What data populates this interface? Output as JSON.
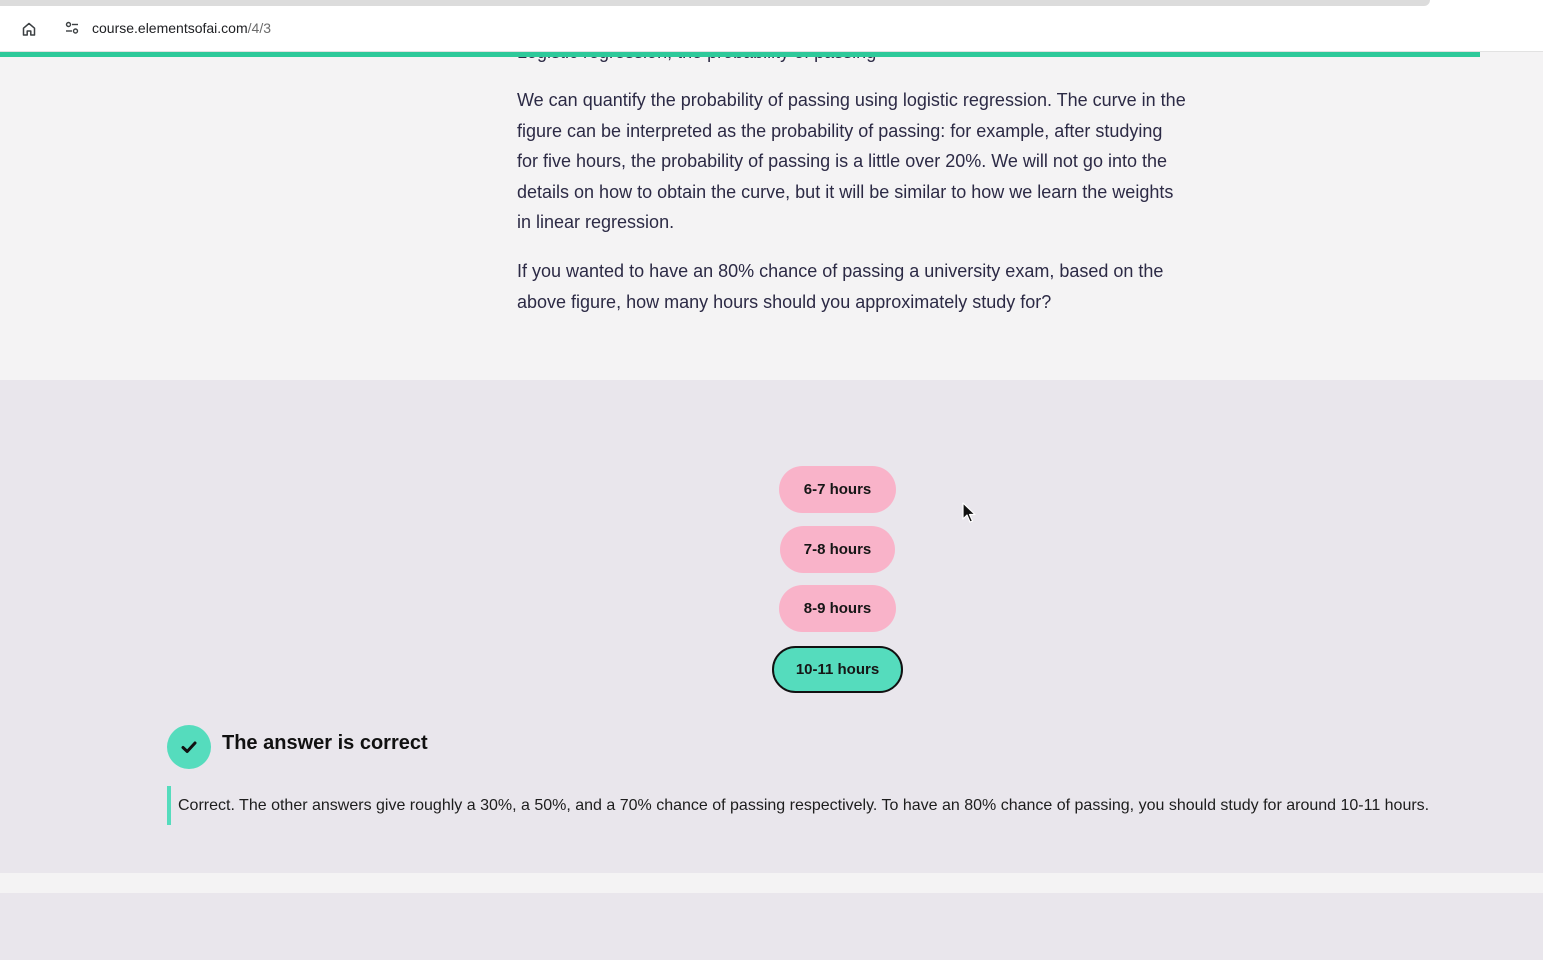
{
  "browser": {
    "url_domain": "course.elementsofai.com",
    "url_path": "/4/3",
    "icons": {
      "home": "home-icon",
      "site_info": "site-settings-icon"
    }
  },
  "reading_progress": {
    "fraction": 0.959,
    "color": "#2ec99a"
  },
  "article": {
    "cut_off_line": "Logistic regression, the probability of passing",
    "paragraphs": [
      "We can quantify the probability of passing using logistic regression. The curve in the figure can be interpreted as the probability of passing: for example, after studying for five hours, the probability of passing is a little over 20%. We will not go into the details on how to obtain the curve, but it will be similar to how we learn the weights in linear regression.",
      "If you wanted to have an 80% chance of passing a university exam, based on the above figure, how many hours should you approximately study for?"
    ]
  },
  "quiz": {
    "options": [
      {
        "label": "6-7 hours",
        "state": "incorrect"
      },
      {
        "label": "7-8 hours",
        "state": "incorrect"
      },
      {
        "label": "8-9 hours",
        "state": "incorrect"
      },
      {
        "label": "10-11 hours",
        "state": "selected-correct"
      }
    ],
    "result": {
      "icon": "checkmark-icon",
      "title": "The answer is correct",
      "feedback": "Correct. The other answers give roughly a 30%, a 50%, and a 70% chance of passing respectively. To have an 80% chance of passing, you should study for around 10-11 hours."
    },
    "colors": {
      "incorrect": "#f9b3c9",
      "correct": "#55dcbd"
    }
  }
}
